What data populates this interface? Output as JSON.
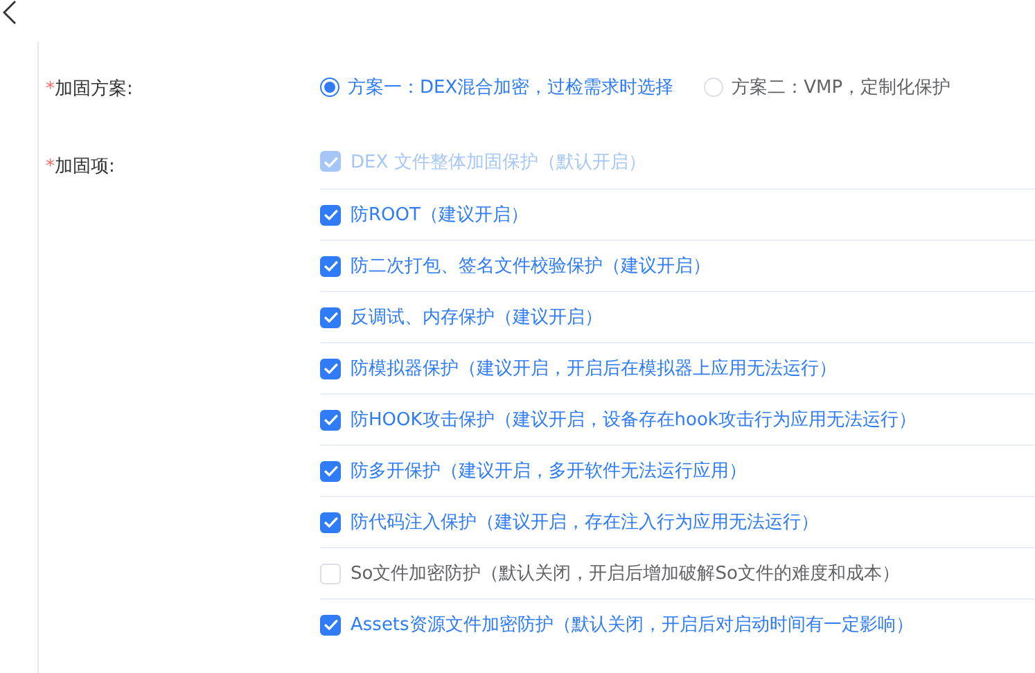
{
  "scheme": {
    "required_mark": "*",
    "label": "加固方案:",
    "options": [
      {
        "label": "方案一：DEX混合加密，过检需求时选择",
        "selected": true
      },
      {
        "label": "方案二：VMP，定制化保护",
        "selected": false
      }
    ]
  },
  "items": {
    "required_mark": "*",
    "label": "加固项:",
    "options": [
      {
        "label": "DEX 文件整体加固保护（默认开启）",
        "checked": true,
        "disabled": true
      },
      {
        "label": "防ROOT（建议开启）",
        "checked": true,
        "disabled": false
      },
      {
        "label": "防二次打包、签名文件校验保护（建议开启）",
        "checked": true,
        "disabled": false
      },
      {
        "label": "反调试、内存保护（建议开启）",
        "checked": true,
        "disabled": false
      },
      {
        "label": "防模拟器保护（建议开启，开启后在模拟器上应用无法运行）",
        "checked": true,
        "disabled": false
      },
      {
        "label": "防HOOK攻击保护（建议开启，设备存在hook攻击行为应用无法运行）",
        "checked": true,
        "disabled": false
      },
      {
        "label": "防多开保护（建议开启，多开软件无法运行应用）",
        "checked": true,
        "disabled": false
      },
      {
        "label": "防代码注入保护（建议开启，存在注入行为应用无法运行）",
        "checked": true,
        "disabled": false
      },
      {
        "label": "So文件加密防护（默认关闭，开启后增加破解So文件的难度和成本）",
        "checked": false,
        "disabled": false
      },
      {
        "label": "Assets资源文件加密防护（默认关闭，开启后对启动时间有一定影响）",
        "checked": true,
        "disabled": false
      }
    ]
  }
}
